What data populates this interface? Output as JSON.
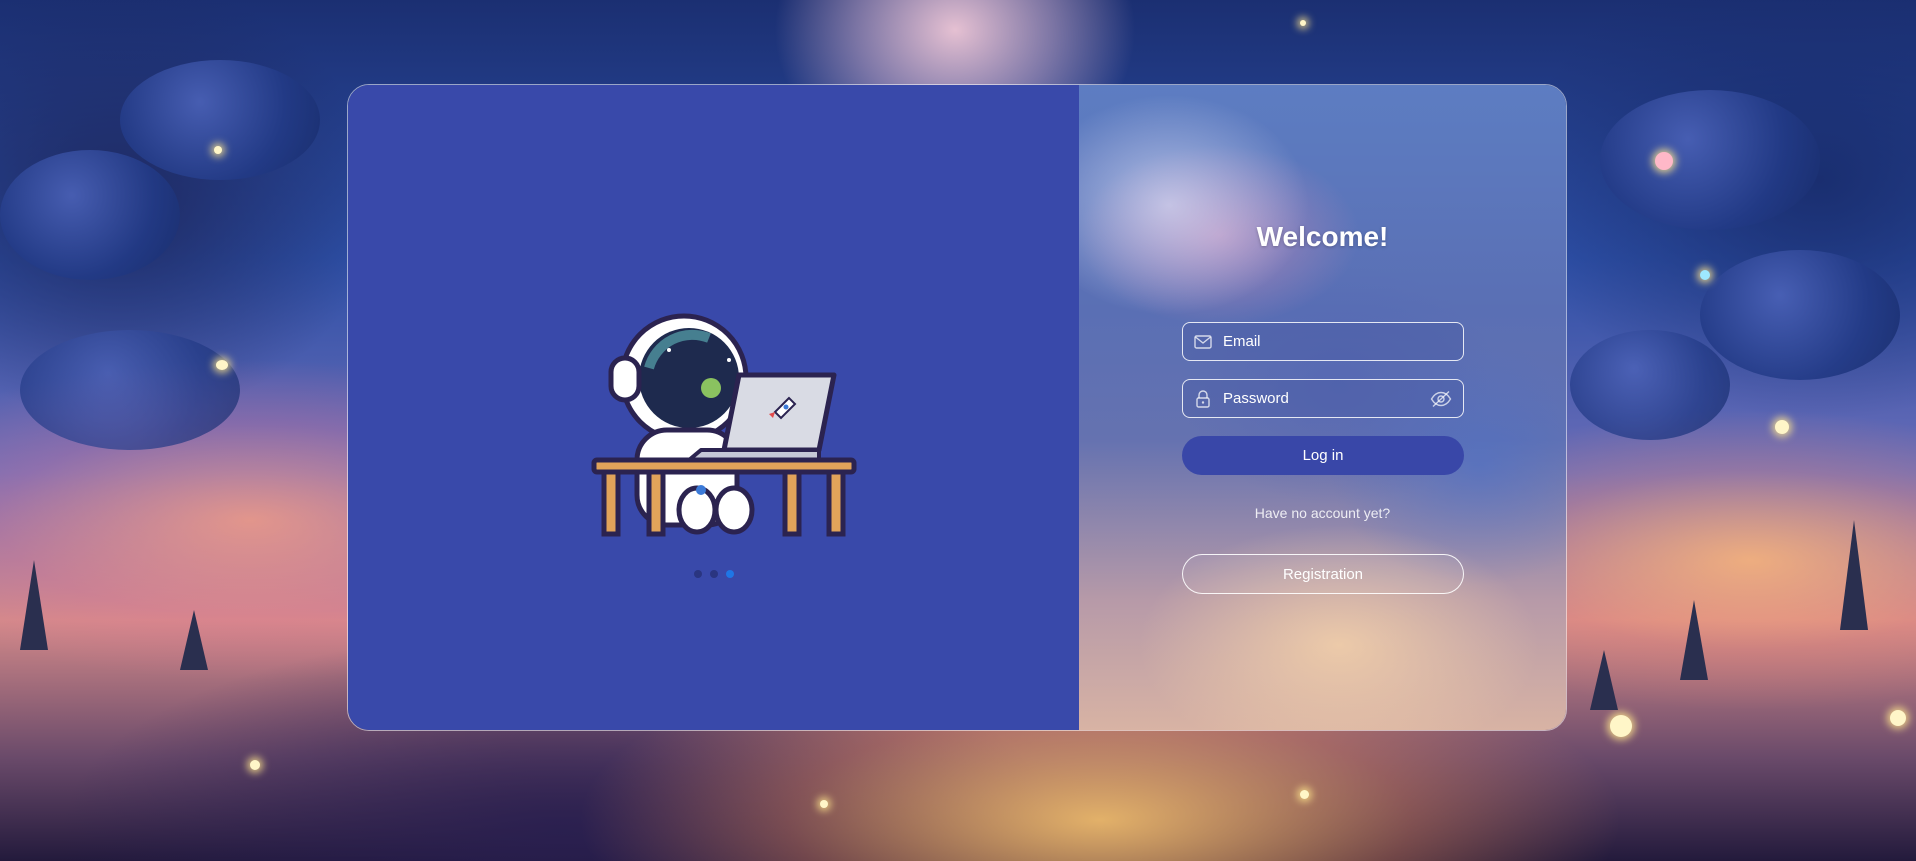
{
  "login": {
    "title": "Welcome!",
    "email_placeholder": "Email",
    "password_placeholder": "Password",
    "login_label": "Log in",
    "no_account_text": "Have no account yet?",
    "register_label": "Registration"
  },
  "carousel": {
    "slide_count": 3,
    "active_index": 2
  },
  "icons": {
    "email": "envelope-icon",
    "password": "lock-icon",
    "visibility": "eye-off-icon"
  },
  "colors": {
    "left_panel": "#3949aa",
    "primary_button": "#3947a8",
    "active_dot": "#1f76e6"
  }
}
